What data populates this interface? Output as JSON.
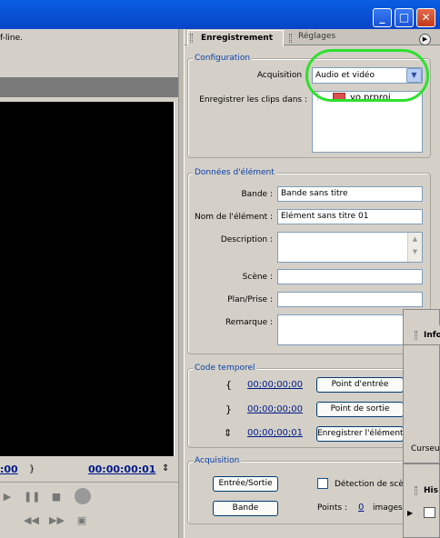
{
  "window": {
    "minimize_label": "_",
    "maximize_label": "□",
    "close_label": "✕"
  },
  "monitor": {
    "status_text": "f-line.",
    "timecode_in": ":00",
    "timecode_out": "00:00:00:01",
    "bracket_right": "}"
  },
  "tabs": {
    "active": "Enregistrement",
    "inactive": "Réglages"
  },
  "configuration": {
    "legend": "Configuration",
    "acquisition_label": "Acquisition :",
    "acquisition_value": "Audio et vidéo",
    "save_clips_label": "Enregistrer les clips dans :",
    "save_location": "yo.prproj"
  },
  "clip_data": {
    "legend": "Données d'élément",
    "tape_label": "Bande :",
    "tape_value": "Bande sans titre",
    "clip_name_label": "Nom de l'élément :",
    "clip_name_value": "Elément sans titre 01",
    "description_label": "Description :",
    "scene_label": "Scène :",
    "shot_label": "Plan/Prise :",
    "comment_label": "Remarque :"
  },
  "timecode": {
    "legend": "Code temporel",
    "in_value": "00;00;00;00",
    "out_value": "00;00;00;00",
    "duration_value": "00;00;00;01",
    "set_in_label": "Point d'entrée",
    "set_out_label": "Point de sortie",
    "log_clip_label": "Enregistrer l'élément"
  },
  "capture": {
    "legend": "Acquisition",
    "in_out_label": "Entrée/Sortie",
    "tape_label": "Bande",
    "scene_detect_label": "Détection de scè",
    "handles_label": "Points :",
    "handles_value": "0",
    "handles_unit": "images"
  },
  "panels": {
    "info_title": "Info",
    "info_cursor": "Curseu",
    "history_title": "His"
  },
  "colors": {
    "highlight": "#2ee02e",
    "legend": "#0a3fa8",
    "timecode": "#001a8a"
  }
}
